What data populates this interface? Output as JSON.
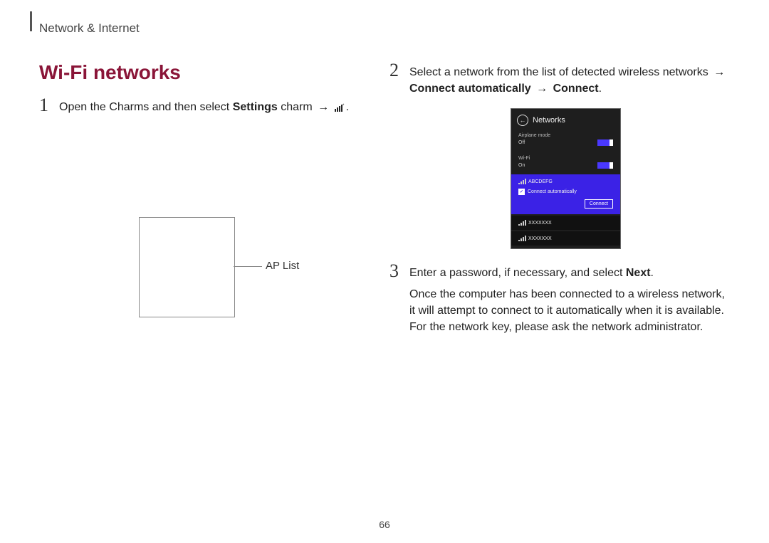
{
  "breadcrumb": "Network & Internet",
  "section_title": "Wi-Fi networks",
  "page_number": "66",
  "step1": {
    "num": "1",
    "pre": "Open the Charms and then select ",
    "bold1": "Settings",
    "post1": " charm ",
    "arrow1": "→",
    "icon": "wireless-icon",
    "period": "."
  },
  "ap_list_label": "AP List",
  "step2": {
    "num": "2",
    "line1": "Select a network from the list of detected wireless networks ",
    "arrow1": "→",
    "bold1": " Connect automatically ",
    "arrow2": "→",
    "bold2": " Connect",
    "period": "."
  },
  "networks_panel": {
    "title": "Networks",
    "airplane_label": "Airplane mode",
    "airplane_state": "Off",
    "wifi_label": "Wi-Fi",
    "wifi_state": "On",
    "selected_network": "ABCDEFG",
    "connect_auto_label": "Connect automatically",
    "connect_button": "Connect",
    "other_networks": [
      "XXXXXXX",
      "XXXXXXX"
    ]
  },
  "step3": {
    "num": "3",
    "line1_pre": "Enter a password, if necessary, and select ",
    "line1_bold": "Next",
    "line1_post": ".",
    "para": "Once the computer has been connected to a wireless network, it will attempt to connect to it automatically when it is available. For the network key, please ask the network administrator."
  }
}
